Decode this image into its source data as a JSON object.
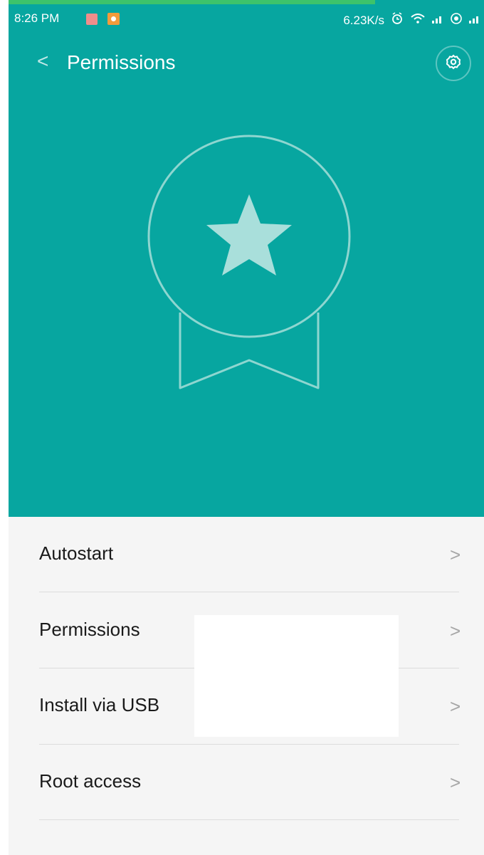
{
  "status": {
    "time": "8:26 PM",
    "network_speed": "6.23K/s",
    "icons": [
      "alarm-clock-icon",
      "wifi-icon",
      "signal-icon",
      "sync-icon",
      "signal-icon"
    ]
  },
  "header": {
    "title": "Permissions",
    "back_icon": "chevron-left-icon",
    "settings_icon": "gear-icon"
  },
  "hero": {
    "icon": "award-star-badge-icon"
  },
  "menu": {
    "items": [
      {
        "label": "Autostart"
      },
      {
        "label": "Permissions"
      },
      {
        "label": "Install via USB"
      },
      {
        "label": "Root access"
      }
    ],
    "chevron": ">"
  },
  "colors": {
    "teal": "#07a6a0",
    "status_green": "#3dc36b",
    "menu_bg": "#f5f5f5",
    "chevron": "#a6a6a6",
    "divider": "#dcdcdc"
  }
}
